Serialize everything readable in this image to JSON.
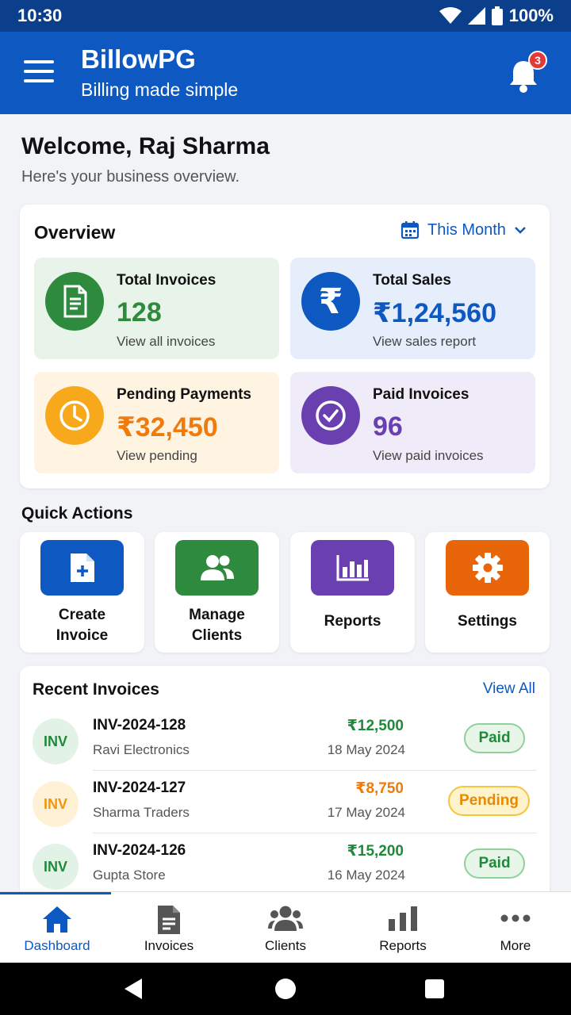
{
  "status_bar": {
    "time": "10:30",
    "battery": "100%"
  },
  "app_bar": {
    "title": "BillowPG",
    "subtitle": "Billing made simple",
    "notification_count": "3"
  },
  "welcome": {
    "title": "Welcome, Raj Sharma",
    "subtitle": "Here's your business overview."
  },
  "overview": {
    "title": "Overview",
    "period": "This Month",
    "tiles": [
      {
        "label": "Total Invoices",
        "value": "128",
        "link": "View all invoices",
        "color": "#2e8b3e",
        "bg": "#e8f4ea",
        "icon": "invoice-icon"
      },
      {
        "label": "Total Sales",
        "value": "₹1,24,560",
        "link": "View sales report",
        "color": "#0d58c1",
        "bg": "#e6eefb",
        "icon": "rupee-icon"
      },
      {
        "label": "Pending Payments",
        "value": "₹32,450",
        "link": "View pending",
        "color": "#f07b0a",
        "bg": "#fff3e2",
        "icon": "clock-icon"
      },
      {
        "label": "Paid Invoices",
        "value": "96",
        "link": "View paid invoices",
        "color": "#6a3fb0",
        "bg": "#efebf8",
        "icon": "check-circle-icon"
      }
    ]
  },
  "quick_actions": {
    "title": "Quick Actions",
    "items": [
      {
        "label": "Create\nInvoice",
        "color": "#0d58c1",
        "icon": "add-document-icon"
      },
      {
        "label": "Manage\nClients",
        "color": "#2e8b3e",
        "icon": "users-icon"
      },
      {
        "label": "Reports",
        "color": "#6a3fb0",
        "icon": "bar-chart-icon"
      },
      {
        "label": "Settings",
        "color": "#e8650a",
        "icon": "gear-icon"
      }
    ]
  },
  "recent_invoices": {
    "title": "Recent Invoices",
    "view_all": "View All",
    "rows": [
      {
        "avatar": "INV",
        "number": "INV-2024-128",
        "client": "Ravi Electronics",
        "amount": "₹12,500",
        "date": "18 May 2024",
        "status": "Paid"
      },
      {
        "avatar": "INV",
        "number": "INV-2024-127",
        "client": "Sharma Traders",
        "amount": "₹8,750",
        "date": "17 May 2024",
        "status": "Pending"
      },
      {
        "avatar": "INV",
        "number": "INV-2024-126",
        "client": "Gupta Store",
        "amount": "₹15,200",
        "date": "16 May 2024",
        "status": "Paid"
      }
    ]
  },
  "bottom_nav": {
    "active": "Dashboard",
    "items": [
      {
        "label": "Dashboard",
        "icon": "home-icon"
      },
      {
        "label": "Invoices",
        "icon": "document-icon"
      },
      {
        "label": "Clients",
        "icon": "users-icon"
      },
      {
        "label": "Reports",
        "icon": "bar-chart-icon"
      },
      {
        "label": "More",
        "icon": "more-icon"
      }
    ]
  },
  "colors": {
    "primary": "#0d58c1",
    "paid": "#1e8a3a",
    "pending": "#f07b0a"
  }
}
